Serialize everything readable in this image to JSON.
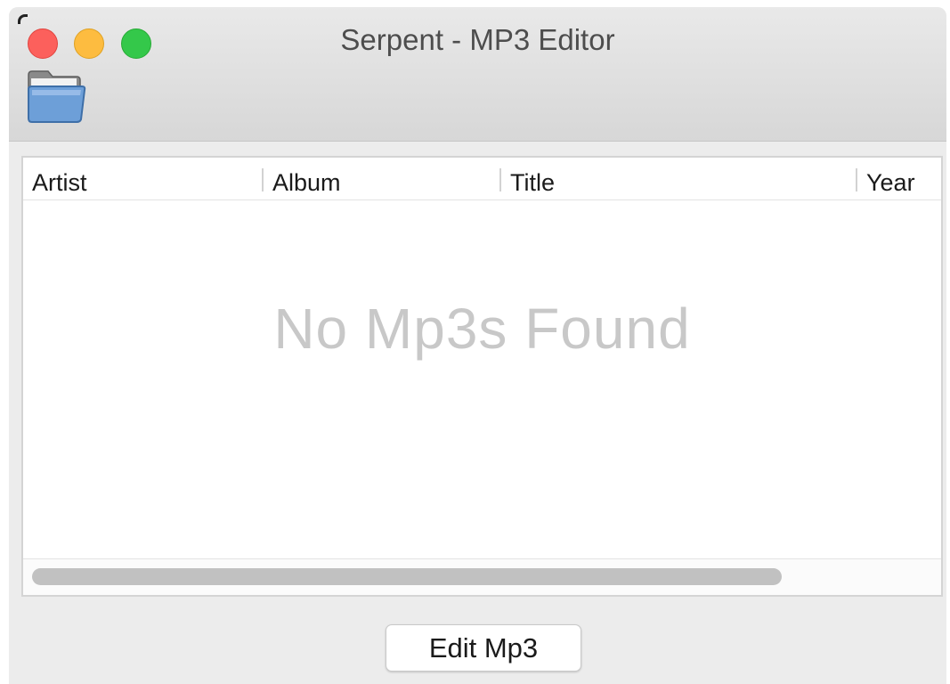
{
  "window": {
    "title": "Serpent - MP3 Editor"
  },
  "toolbar": {
    "open_icon": "folder-open-icon"
  },
  "table": {
    "columns": [
      "Artist",
      "Album",
      "Title",
      "Year"
    ],
    "rows": [],
    "empty_message": "No Mp3s Found"
  },
  "footer": {
    "edit_button_label": "Edit Mp3"
  },
  "colors": {
    "close": "#fc605c",
    "minimize": "#fdbc40",
    "maximize": "#34c84a",
    "empty_text": "#c8c8c8"
  }
}
